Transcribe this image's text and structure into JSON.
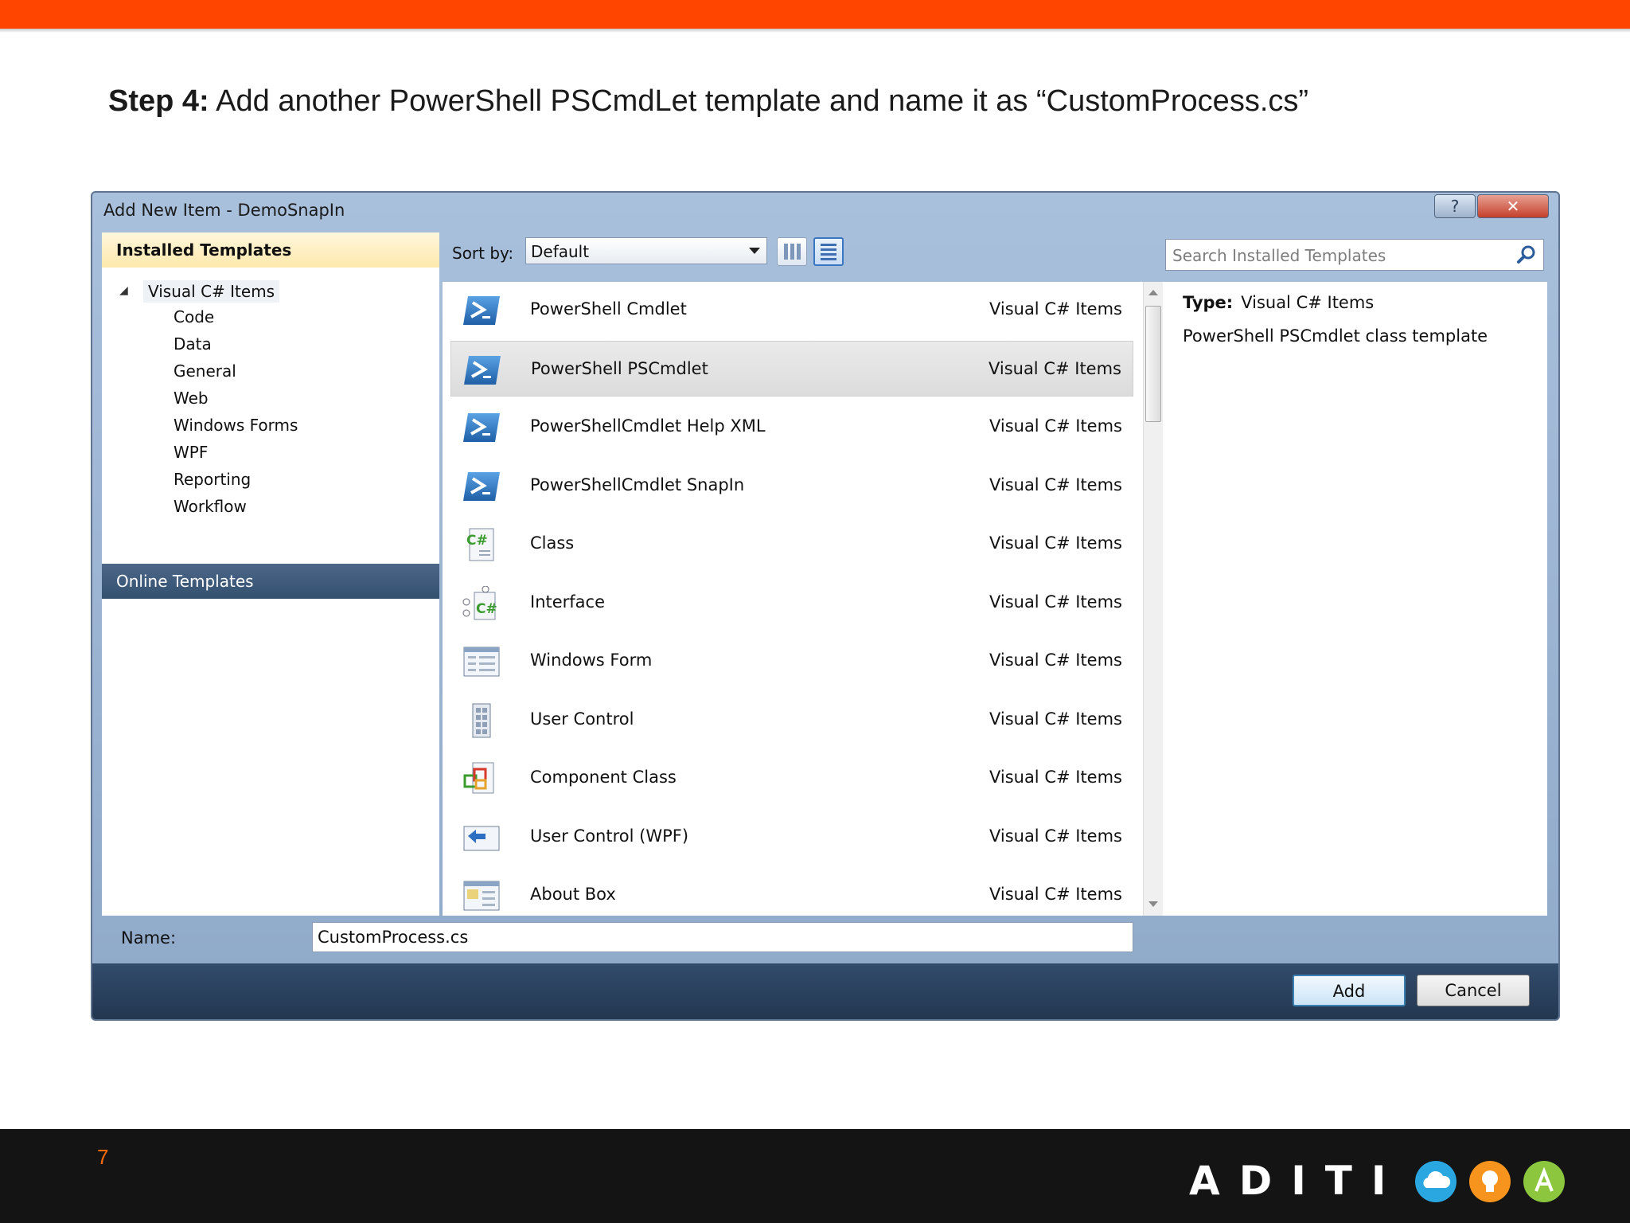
{
  "slide": {
    "step_label": "Step 4:",
    "step_text": " Add another PowerShell PSCmdLet template and name it as “CustomProcess.cs”",
    "page_number": "7",
    "brand": "ADITI",
    "accent": "#ff4500"
  },
  "dialog": {
    "title": "Add New Item - DemoSnapIn",
    "help_label": "?",
    "close_label": "✕",
    "left_pane": {
      "installed_header": "Installed Templates",
      "tree_root": "Visual C# Items",
      "categories": [
        "Code",
        "Data",
        "General",
        "Web",
        "Windows Forms",
        "WPF",
        "Reporting",
        "Workflow"
      ],
      "online_header": "Online Templates"
    },
    "toolbar": {
      "sort_by_label": "Sort by:",
      "sort_value": "Default"
    },
    "search": {
      "placeholder": "Search Installed Templates"
    },
    "templates": [
      {
        "name": "PowerShell Cmdlet",
        "type": "Visual C# Items",
        "icon": "powershell-icon"
      },
      {
        "name": "PowerShell PSCmdlet",
        "type": "Visual C# Items",
        "icon": "powershell-icon",
        "selected": true
      },
      {
        "name": "PowerShellCmdlet Help XML",
        "type": "Visual C# Items",
        "icon": "powershell-icon"
      },
      {
        "name": "PowerShellCmdlet SnapIn",
        "type": "Visual C# Items",
        "icon": "powershell-icon"
      },
      {
        "name": "Class",
        "type": "Visual C# Items",
        "icon": "csharp-class-icon"
      },
      {
        "name": "Interface",
        "type": "Visual C# Items",
        "icon": "csharp-interface-icon"
      },
      {
        "name": "Windows Form",
        "type": "Visual C# Items",
        "icon": "windows-form-icon"
      },
      {
        "name": "User Control",
        "type": "Visual C# Items",
        "icon": "user-control-icon"
      },
      {
        "name": "Component Class",
        "type": "Visual C# Items",
        "icon": "component-class-icon"
      },
      {
        "name": "User Control (WPF)",
        "type": "Visual C# Items",
        "icon": "wpf-user-control-icon"
      },
      {
        "name": "About Box",
        "type": "Visual C# Items",
        "icon": "about-box-icon"
      }
    ],
    "details": {
      "type_label": "Type:",
      "type_value": "Visual C# Items",
      "description": "PowerShell PSCmdlet class template"
    },
    "name_field": {
      "label": "Name:",
      "value": "CustomProcess.cs"
    },
    "buttons": {
      "add": "Add",
      "cancel": "Cancel"
    }
  }
}
